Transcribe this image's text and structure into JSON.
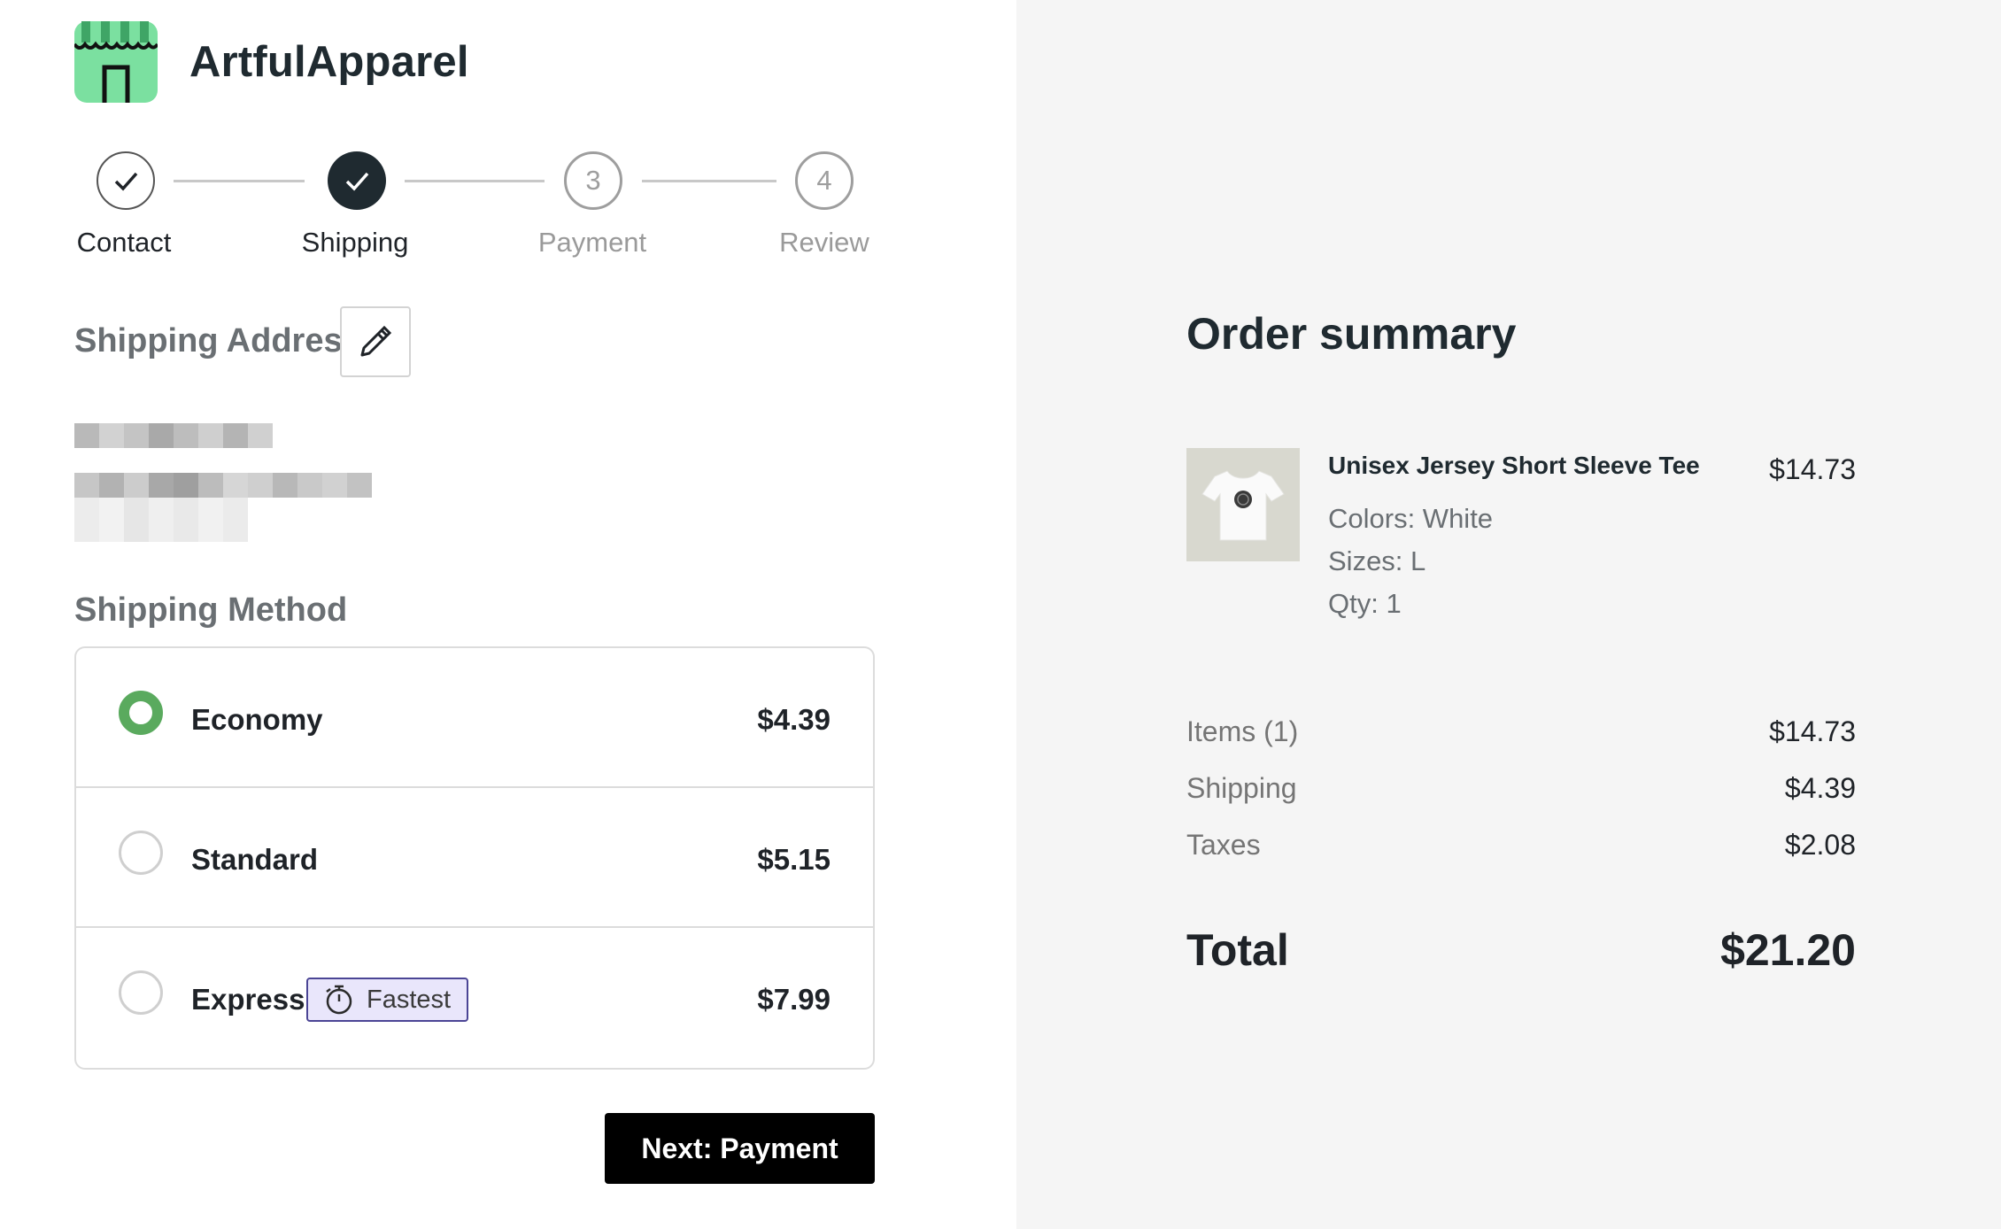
{
  "brand": {
    "name": "ArtfulApparel",
    "logo_icon": "storefront-icon",
    "logo_color": "#7be0a0"
  },
  "stepper": {
    "steps": [
      {
        "label": "Contact",
        "state": "completed",
        "number": "1"
      },
      {
        "label": "Shipping",
        "state": "current-completed",
        "number": "2"
      },
      {
        "label": "Payment",
        "state": "upcoming",
        "number": "3"
      },
      {
        "label": "Review",
        "state": "upcoming",
        "number": "4"
      }
    ]
  },
  "shipping_address": {
    "title": "Shipping Address",
    "edit_icon": "pencil-icon"
  },
  "shipping_method": {
    "title": "Shipping Method",
    "options": [
      {
        "name": "Economy",
        "price": "$4.39",
        "selected": true
      },
      {
        "name": "Standard",
        "price": "$5.15",
        "selected": false
      },
      {
        "name": "Express",
        "price": "$7.99",
        "selected": false,
        "badge": "Fastest",
        "badge_icon": "stopwatch-icon"
      }
    ]
  },
  "actions": {
    "next_label": "Next: Payment"
  },
  "summary": {
    "title": "Order summary",
    "item": {
      "name": "Unisex Jersey Short Sleeve Tee",
      "price": "$14.73",
      "colors": "Colors: White",
      "sizes": "Sizes: L",
      "qty": "Qty: 1",
      "image_icon": "tshirt-icon"
    },
    "rows": [
      {
        "label": "Items (1)",
        "value": "$14.73"
      },
      {
        "label": "Shipping",
        "value": "$4.39"
      },
      {
        "label": "Taxes",
        "value": "$2.08"
      }
    ],
    "total_label": "Total",
    "total_value": "$21.20"
  },
  "colors": {
    "accent_green": "#5aaa5e",
    "dark": "#1f2a30",
    "badge_bg": "#e9e6fb",
    "badge_border": "#4b4595",
    "summary_bg": "#f5f5f5"
  }
}
